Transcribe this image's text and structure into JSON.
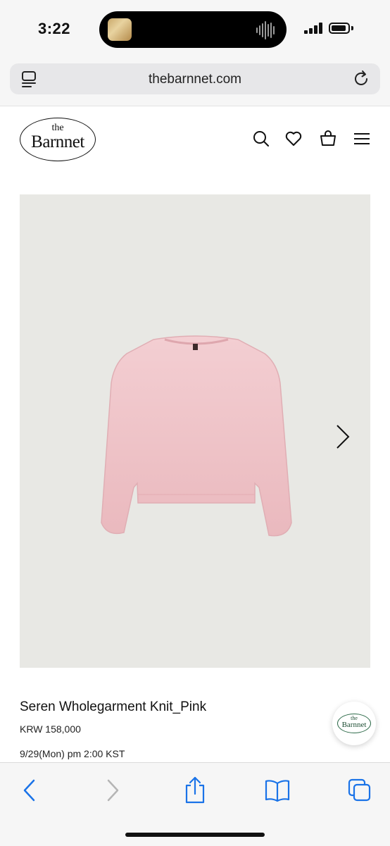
{
  "status": {
    "time": "3:22"
  },
  "browser": {
    "url": "thebarnnet.com"
  },
  "site": {
    "logo_top": "the",
    "logo_name": "Barnnet"
  },
  "product": {
    "title": "Seren Wholegarment Knit_Pink",
    "price": "KRW 158,000",
    "release": "9/29(Mon) pm 2:00 KST",
    "image_color": "#efc6ca"
  },
  "chat_widget": {
    "logo_top": "the",
    "logo_name": "Barnnet"
  },
  "icons": {
    "header": [
      "search-icon",
      "heart-icon",
      "bag-icon",
      "menu-icon"
    ],
    "toolbar": [
      "back-icon",
      "forward-icon",
      "share-icon",
      "bookmarks-icon",
      "tabs-icon"
    ]
  },
  "colors": {
    "accent": "#1a73e8",
    "brand_green": "#2e6b4a"
  }
}
